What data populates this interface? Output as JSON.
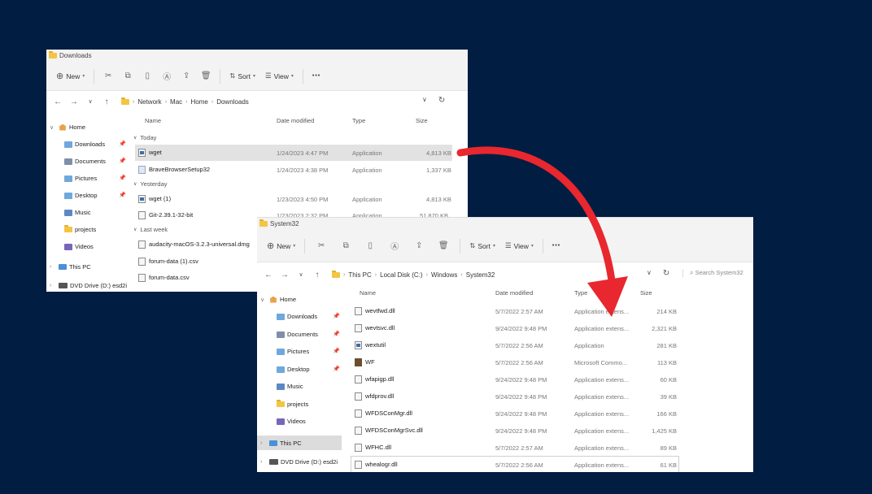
{
  "downloads_window": {
    "title": "Downloads",
    "toolbar": {
      "new_label": "New",
      "sort_label": "Sort",
      "view_label": "View",
      "more_label": "•••"
    },
    "breadcrumb": [
      "Network",
      "Mac",
      "Home",
      "Downloads"
    ],
    "sidebar": {
      "home": "Home",
      "items": [
        {
          "label": "Downloads",
          "icon": "downloads-folder-icon"
        },
        {
          "label": "Documents",
          "icon": "documents-folder-icon"
        },
        {
          "label": "Pictures",
          "icon": "pictures-folder-icon"
        },
        {
          "label": "Desktop",
          "icon": "desktop-folder-icon"
        },
        {
          "label": "Music",
          "icon": "music-folder-icon"
        },
        {
          "label": "projects",
          "icon": "folder-icon"
        },
        {
          "label": "Videos",
          "icon": "videos-folder-icon"
        }
      ],
      "this_pc": "This PC",
      "dvd": "DVD Drive (D:) esd2i"
    },
    "columns": {
      "name": "Name",
      "date": "Date modified",
      "type": "Type",
      "size": "Size"
    },
    "groups": {
      "today": "Today",
      "yesterday": "Yesterday",
      "last_week": "Last week"
    },
    "files": [
      {
        "name": "wget",
        "date": "1/24/2023 4:47 PM",
        "type": "Application",
        "size": "4,813 KB"
      },
      {
        "name": "BraveBrowserSetup32",
        "date": "1/24/2023 4:38 PM",
        "type": "Application",
        "size": "1,337 KB"
      },
      {
        "name": "wget (1)",
        "date": "1/23/2023 4:50 PM",
        "type": "Application",
        "size": "4,813 KB"
      },
      {
        "name": "Git-2.39.1-32-bit",
        "date": "1/23/2023 2:32 PM",
        "type": "Application",
        "size": "51,870 KB"
      },
      {
        "name": "audacity-macOS-3.2.3-universal.dmg",
        "date": "",
        "type": "",
        "size": ""
      },
      {
        "name": "forum-data (1).csv",
        "date": "",
        "type": "",
        "size": ""
      },
      {
        "name": "forum-data.csv",
        "date": "",
        "type": "",
        "size": ""
      }
    ]
  },
  "system32_window": {
    "title": "System32",
    "toolbar": {
      "new_label": "New",
      "sort_label": "Sort",
      "view_label": "View",
      "more_label": "•••"
    },
    "breadcrumb": [
      "This PC",
      "Local Disk (C:)",
      "Windows",
      "System32"
    ],
    "search_placeholder": "Search System32",
    "sidebar": {
      "home": "Home",
      "items": [
        {
          "label": "Downloads",
          "icon": "downloads-folder-icon"
        },
        {
          "label": "Documents",
          "icon": "documents-folder-icon"
        },
        {
          "label": "Pictures",
          "icon": "pictures-folder-icon"
        },
        {
          "label": "Desktop",
          "icon": "desktop-folder-icon"
        },
        {
          "label": "Music",
          "icon": "music-folder-icon"
        },
        {
          "label": "projects",
          "icon": "folder-icon"
        },
        {
          "label": "Videos",
          "icon": "videos-folder-icon"
        }
      ],
      "this_pc": "This PC",
      "dvd": "DVD Drive (D:) esd2i"
    },
    "columns": {
      "name": "Name",
      "date": "Date modified",
      "type": "Type",
      "size": "Size"
    },
    "files": [
      {
        "name": "wevtfwd.dll",
        "date": "5/7/2022 2:57 AM",
        "type": "Application extens...",
        "size": "214 KB"
      },
      {
        "name": "wevtsvc.dll",
        "date": "9/24/2022 9:48 PM",
        "type": "Application extens...",
        "size": "2,321 KB"
      },
      {
        "name": "wextutil",
        "date": "5/7/2022 2:56 AM",
        "type": "Application",
        "size": "281 KB"
      },
      {
        "name": "WF",
        "date": "5/7/2022 2:56 AM",
        "type": "Microsoft Commo...",
        "size": "113 KB"
      },
      {
        "name": "wfapigp.dll",
        "date": "9/24/2022 9:48 PM",
        "type": "Application extens...",
        "size": "60 KB"
      },
      {
        "name": "wfdprov.dll",
        "date": "9/24/2022 9:48 PM",
        "type": "Application extens...",
        "size": "39 KB"
      },
      {
        "name": "WFDSConMgr.dll",
        "date": "9/24/2022 9:48 PM",
        "type": "Application extens...",
        "size": "166 KB"
      },
      {
        "name": "WFDSConMgrSvc.dll",
        "date": "9/24/2022 9:48 PM",
        "type": "Application extens...",
        "size": "1,425 KB"
      },
      {
        "name": "WFHC.dll",
        "date": "5/7/2022 2:57 AM",
        "type": "Application extens...",
        "size": "89 KB"
      },
      {
        "name": "whealogr.dll",
        "date": "5/7/2022 2:56 AM",
        "type": "Application extens...",
        "size": "61 KB"
      }
    ]
  },
  "colors": {
    "background": "#011d42",
    "arrow": "#e8272f",
    "selected_row": "#e2e2e2"
  }
}
